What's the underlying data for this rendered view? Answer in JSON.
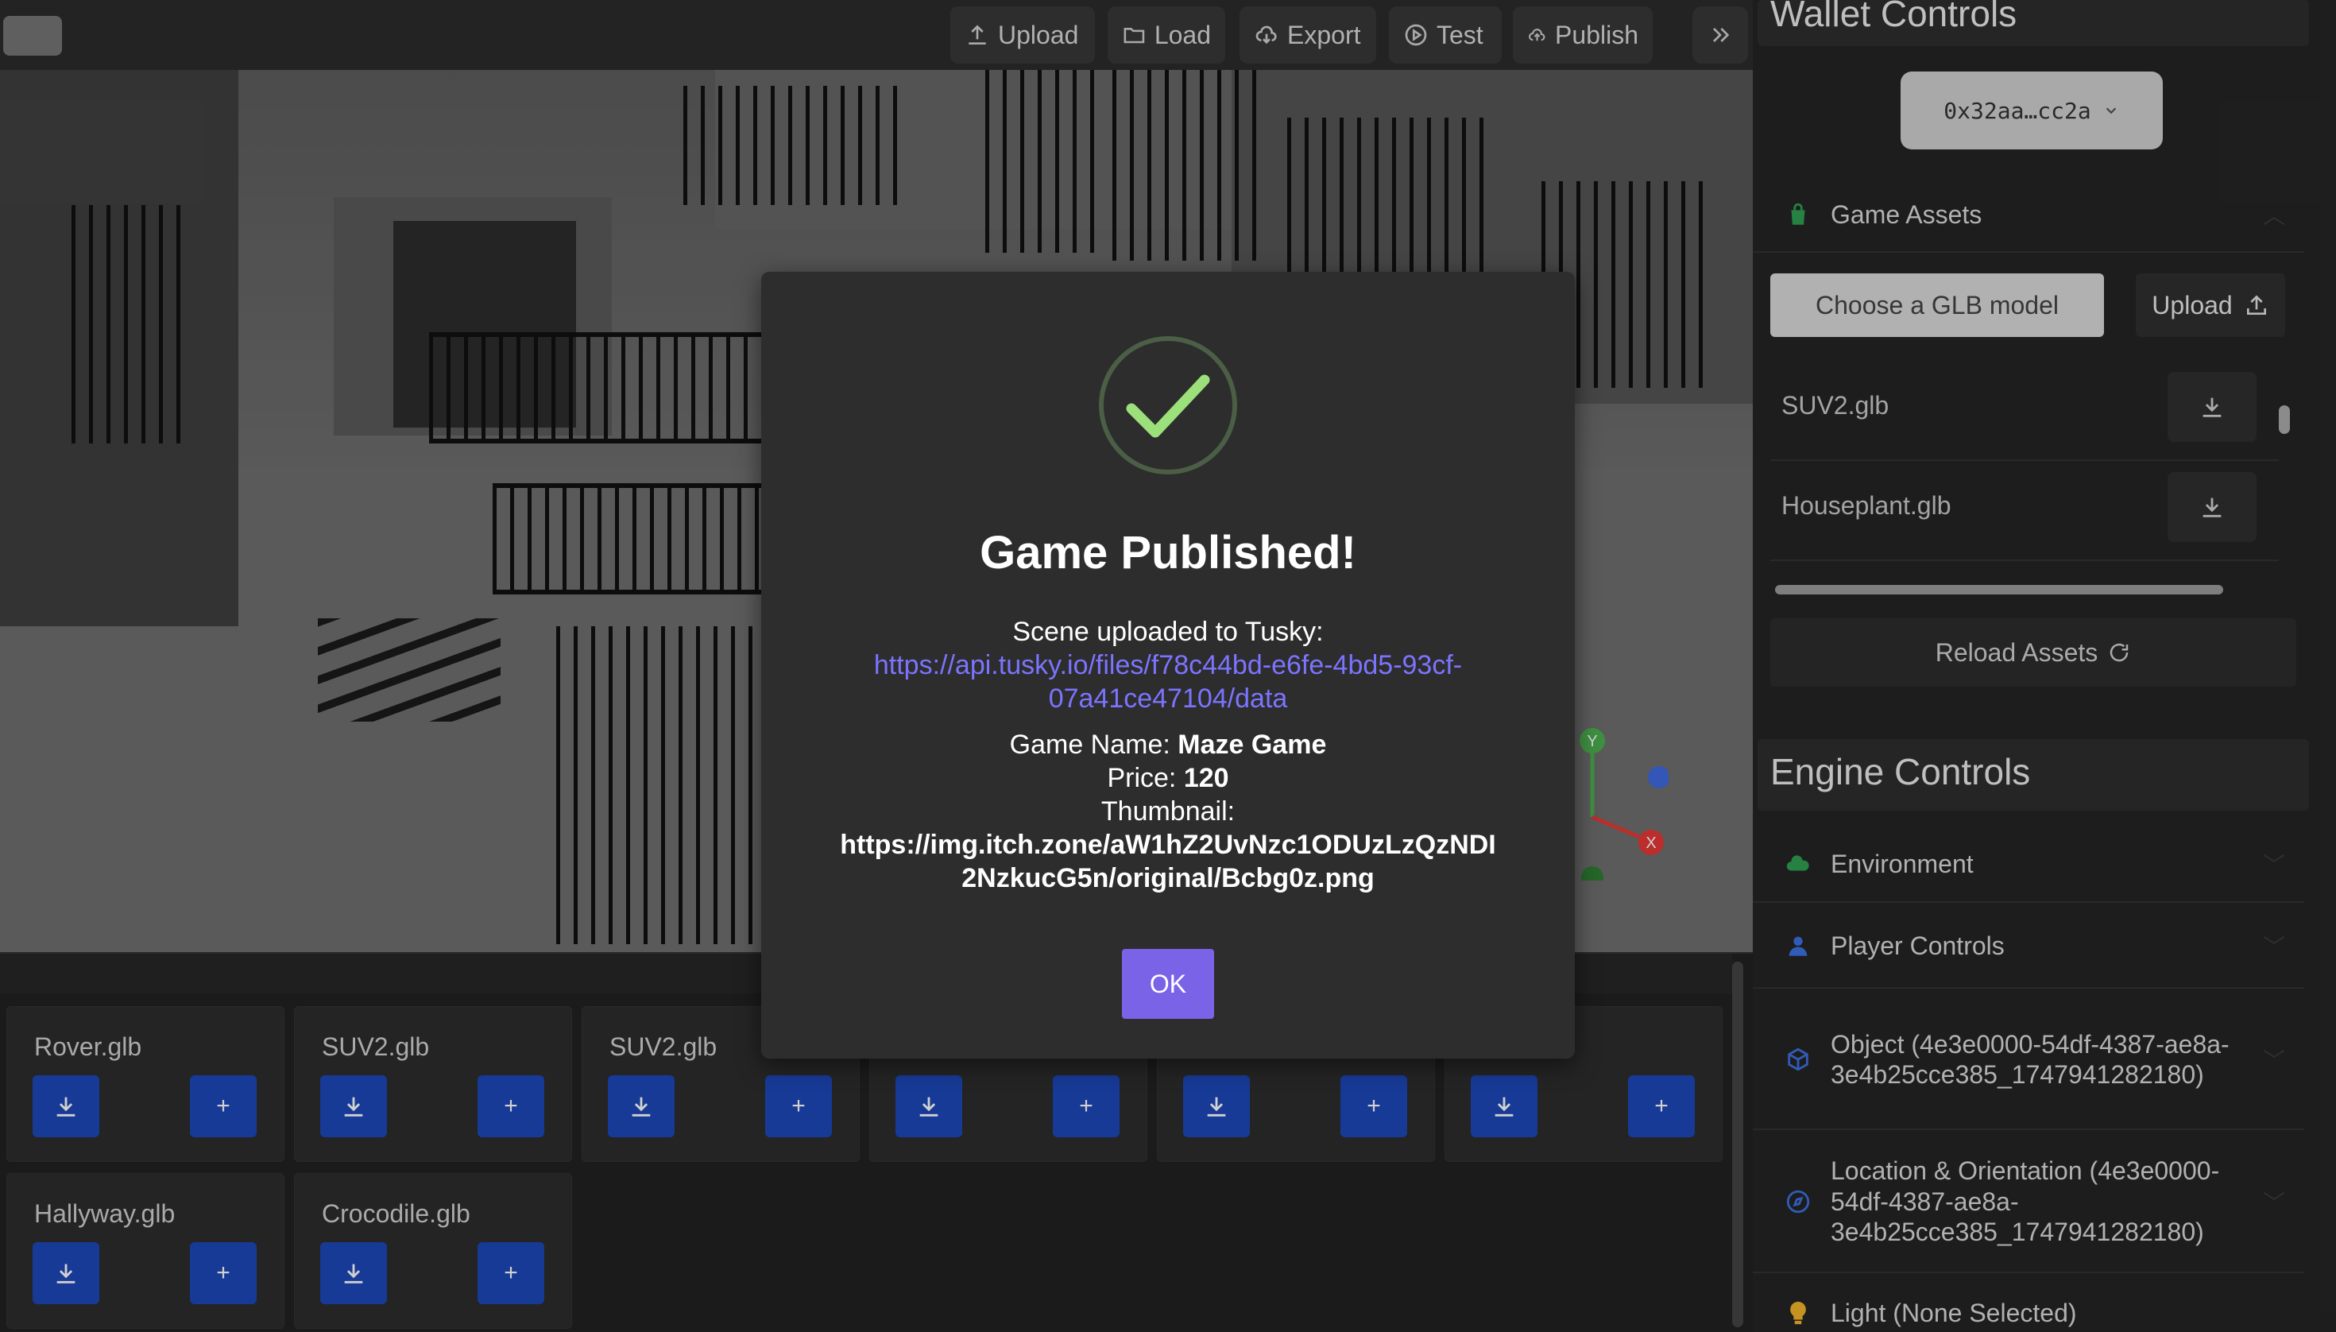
{
  "toolbar": {
    "buttons": [
      {
        "label": "Upload",
        "icon": "upload-icon"
      },
      {
        "label": "Load",
        "icon": "folder-icon"
      },
      {
        "label": "Export",
        "icon": "cloud-download-icon"
      },
      {
        "label": "Test",
        "icon": "play-icon"
      },
      {
        "label": "Publish",
        "icon": "cloud-upload-icon"
      }
    ],
    "expand_icon": "double-chevron-right-icon"
  },
  "tray": {
    "cards": [
      {
        "name": "Rover.glb"
      },
      {
        "name": "SUV2.glb"
      },
      {
        "name": "SUV2.glb"
      },
      {
        "name": ""
      },
      {
        "name": ""
      },
      {
        "name": ""
      },
      {
        "name": "Hallyway.glb"
      },
      {
        "name": "Crocodile.glb"
      }
    ],
    "add_label": "+"
  },
  "panel": {
    "wallet_title": "Wallet Controls",
    "wallet_address": "0x32aa…cc2a",
    "game_assets_label": "Game Assets",
    "choose_glb_label": "Choose a GLB model",
    "upload_label": "Upload",
    "assets": [
      "SUV2.glb",
      "Houseplant.glb"
    ],
    "reload_label": "Reload Assets",
    "engine_title": "Engine Controls",
    "engine_items": [
      {
        "label": "Environment",
        "icon": "cloud-icon",
        "color": "#2e9f52"
      },
      {
        "label": "Player Controls",
        "icon": "person-icon",
        "color": "#3b6fe0"
      },
      {
        "label": "Object (4e3e0000-54df-4387-ae8a-3e4b25cce385_1747941282180)",
        "icon": "cube-icon",
        "color": "#3b6fe0"
      },
      {
        "label": "Location & Orientation (4e3e0000-54df-4387-ae8a-3e4b25cce385_1747941282180)",
        "icon": "compass-icon",
        "color": "#3b6fe0"
      },
      {
        "label": "Light (None Selected)",
        "icon": "lightbulb-icon",
        "color": "#f0b429"
      }
    ]
  },
  "modal": {
    "title": "Game Published!",
    "uploaded_label": "Scene uploaded to Tusky:",
    "url_line1": "https://api.tusky.io/files/f78c44bd-e6fe-4bd5-93cf-",
    "url_line2": "07a41ce47104/data",
    "game_name_label": "Game Name: ",
    "game_name": "Maze Game",
    "price_label": "Price: ",
    "price": "120",
    "thumbnail_label": "Thumbnail:",
    "thumb_line1": "https://img.itch.zone/aW1hZ2UvNzc1ODUzLzQzNDI",
    "thumb_line2": "2NzkucG5n/original/Bcbg0z.png",
    "ok_label": "OK"
  },
  "gizmo": {
    "axes": [
      "Y",
      "X"
    ]
  },
  "colors": {
    "accent": "#7a63e6",
    "link": "#7b74ff",
    "tray_button": "#1d47b8",
    "check": "#9be07a"
  }
}
